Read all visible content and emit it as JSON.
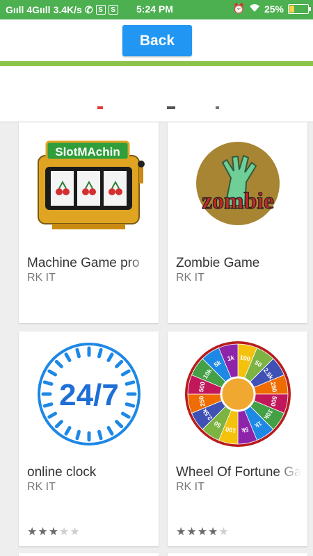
{
  "statusbar": {
    "network": "Gııll 4Gııll",
    "speed": "3.4K/s",
    "time": "5:24 PM",
    "battery": "25%",
    "battery_level": 0.25,
    "icons": [
      "whatsapp-icon",
      "s-icon",
      "s-icon",
      "alarm-icon",
      "wifi-icon",
      "battery-icon"
    ]
  },
  "header": {
    "back_label": "Back",
    "button_color": "#2196f3",
    "accent_line_color": "#8bc34a"
  },
  "apps": [
    {
      "title": "Machine Game pro",
      "developer": "RK IT",
      "icon": "slot-machine-icon",
      "icon_text": "SlotMAchin",
      "rating": null
    },
    {
      "title": "Zombie Game",
      "developer": "RK IT",
      "icon": "zombie-icon",
      "icon_text": "zombie",
      "rating": null
    },
    {
      "title": "online clock",
      "developer": "RK IT",
      "icon": "clock-247-icon",
      "icon_text": "24/7",
      "rating": 3,
      "rating_max": 5
    },
    {
      "title": "Wheel Of Fortune Game",
      "developer": "RK IT",
      "icon": "wheel-of-fortune-icon",
      "rating": 4,
      "rating_max": 5,
      "wheel_labels": [
        "100",
        "50",
        "2.5k",
        "250",
        "500",
        "10k",
        "1k",
        "5k",
        "100",
        "50",
        "2.5k",
        "250",
        "500",
        "10k",
        "5k",
        "1k"
      ]
    }
  ]
}
